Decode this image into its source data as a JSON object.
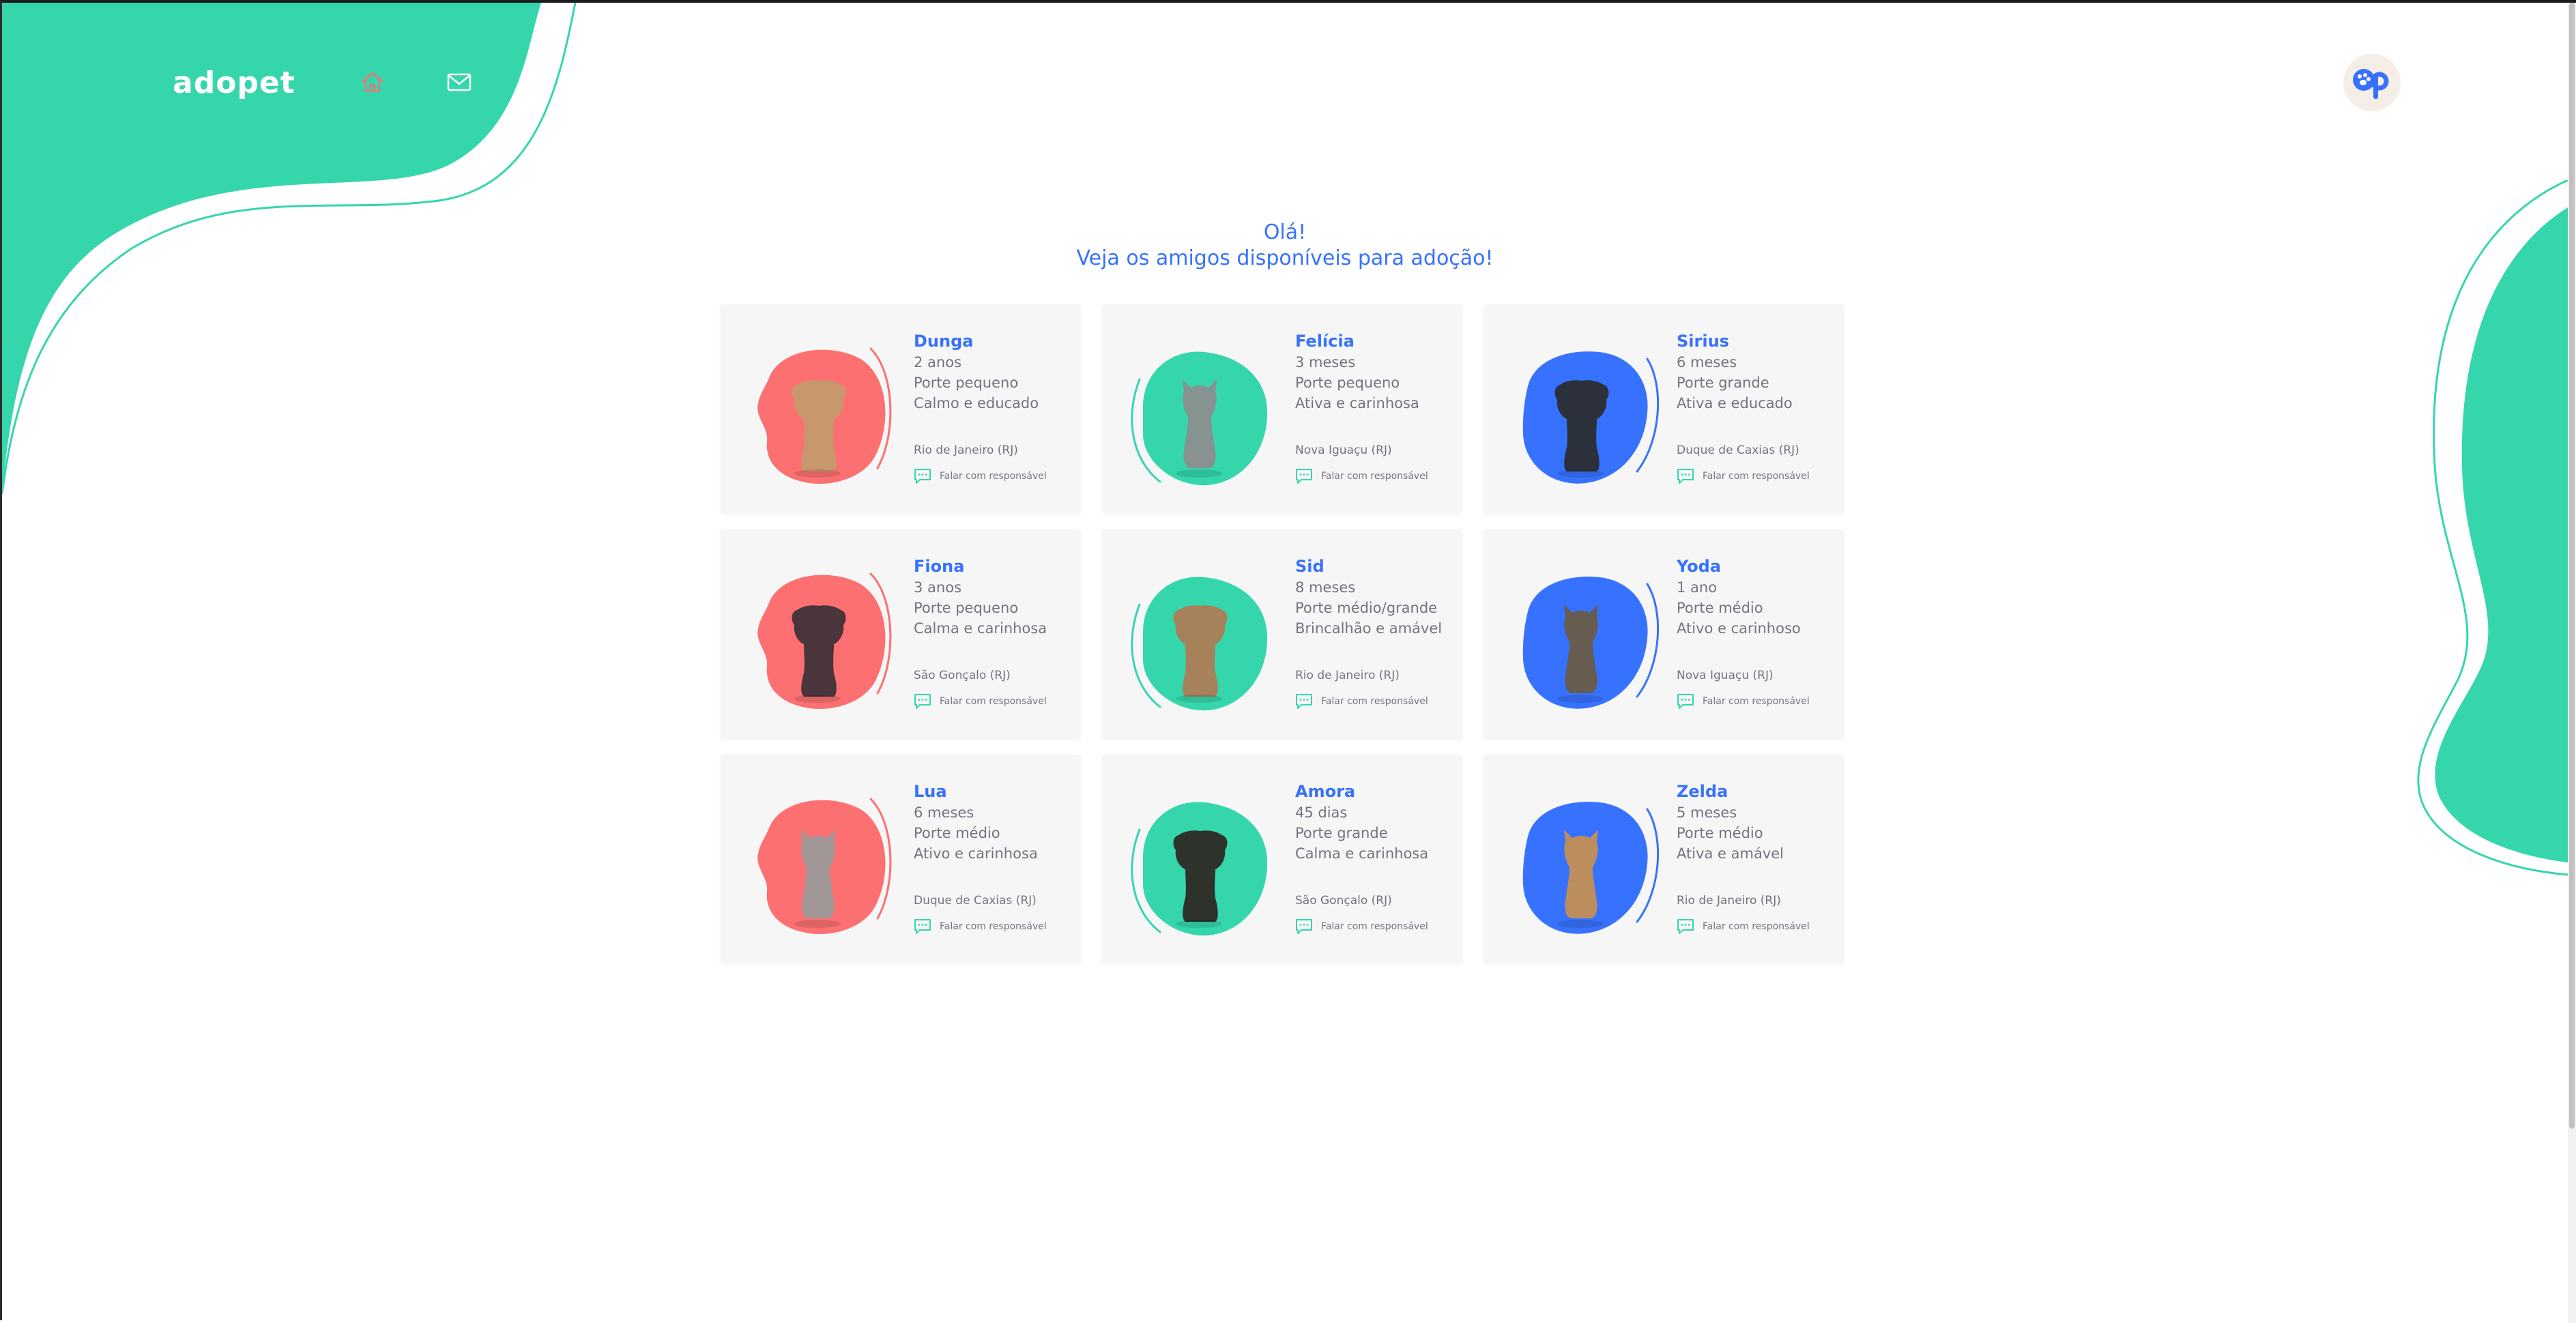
{
  "brand": {
    "logo": "adopet",
    "teal": "#36d6ad",
    "blue": "#3772ff",
    "coral": "#fc7071",
    "card_bg": "#f6f6f6",
    "text_gray": "#737380"
  },
  "header": {
    "nav": [
      {
        "icon": "home-icon"
      },
      {
        "icon": "mail-icon"
      }
    ],
    "avatar_icon": "user-avatar"
  },
  "greeting": {
    "line1": "Olá!",
    "line2": "Veja os amigos disponíveis para adoção!"
  },
  "contact_label": "Falar com responsável",
  "pets": [
    {
      "name": "Dunga",
      "age": "2 anos",
      "size": "Porte pequeno",
      "temperament": "Calmo e educado",
      "city": "Rio de Janeiro (RJ)",
      "blob_color": "#fc7071",
      "animal": "dog"
    },
    {
      "name": "Felícia",
      "age": "3 meses",
      "size": "Porte pequeno",
      "temperament": "Ativa e carinhosa",
      "city": "Nova Iguaçu (RJ)",
      "blob_color": "#36d6ad",
      "animal": "cat"
    },
    {
      "name": "Sirius",
      "age": "6 meses",
      "size": "Porte grande",
      "temperament": "Ativa e educado",
      "city": "Duque de Caxias (RJ)",
      "blob_color": "#3772ff",
      "animal": "dog"
    },
    {
      "name": "Fiona",
      "age": "3 anos",
      "size": "Porte pequeno",
      "temperament": "Calma e carinhosa",
      "city": "São Gonçalo (RJ)",
      "blob_color": "#fc7071",
      "animal": "dog"
    },
    {
      "name": "Sid",
      "age": "8 meses",
      "size": "Porte médio/grande",
      "temperament": "Brincalhão e amável",
      "city": "Rio de Janeiro (RJ)",
      "blob_color": "#36d6ad",
      "animal": "dog"
    },
    {
      "name": "Yoda",
      "age": "1 ano",
      "size": "Porte médio",
      "temperament": "Ativo e carinhoso",
      "city": "Nova Iguaçu (RJ)",
      "blob_color": "#3772ff",
      "animal": "cat"
    },
    {
      "name": "Lua",
      "age": "6 meses",
      "size": "Porte médio",
      "temperament": "Ativo e carinhosa",
      "city": "Duque de Caxias (RJ)",
      "blob_color": "#fc7071",
      "animal": "cat"
    },
    {
      "name": "Amora",
      "age": "45 dias",
      "size": "Porte grande",
      "temperament": "Calma e carinhosa",
      "city": "São Gonçalo (RJ)",
      "blob_color": "#36d6ad",
      "animal": "dog"
    },
    {
      "name": "Zelda",
      "age": "5 meses",
      "size": "Porte médio",
      "temperament": "Ativa e amável",
      "city": "Rio de Janeiro (RJ)",
      "blob_color": "#3772ff",
      "animal": "cat"
    }
  ]
}
